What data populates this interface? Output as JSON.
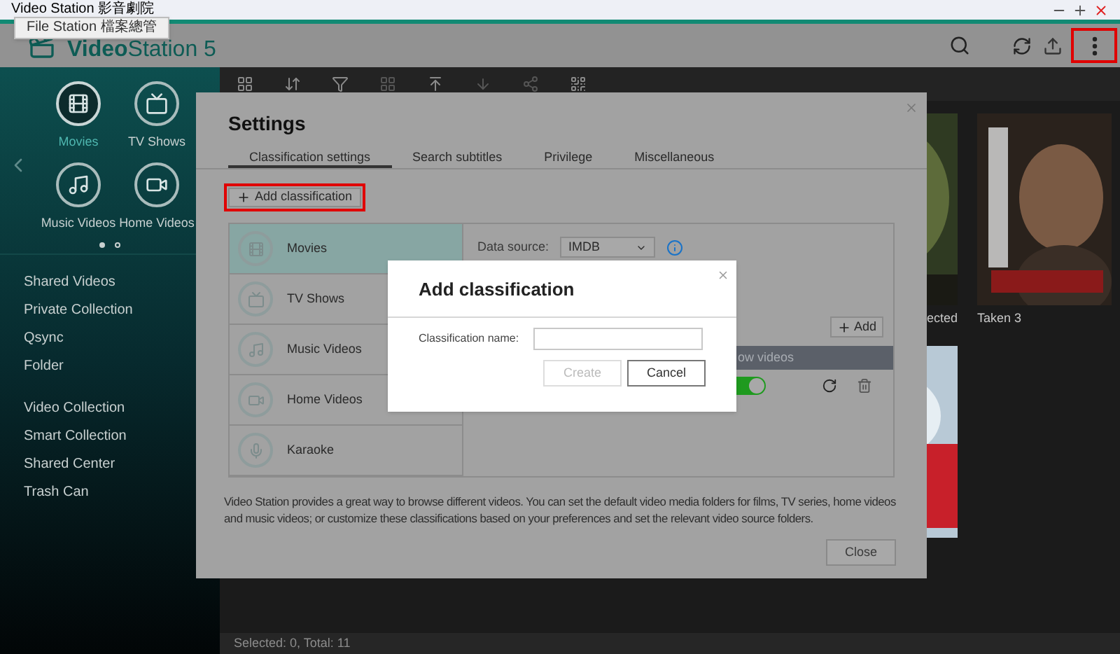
{
  "title_bar": {
    "title": "Video Station 影音劇院"
  },
  "tooltip": {
    "text": "File Station 檔案總管"
  },
  "header": {
    "logo": "**Video**Station 5"
  },
  "sidebar": {
    "apps": [
      {
        "kind": "film",
        "label": "Movies",
        "selected": true
      },
      {
        "kind": "tv",
        "label": "TV Shows",
        "selected": false
      },
      {
        "kind": "music",
        "label": "Music Videos",
        "selected": false
      },
      {
        "kind": "camera",
        "label": "Home Videos",
        "selected": false
      }
    ],
    "page_dots": [
      {
        "selected": true
      },
      {
        "selected": false
      }
    ],
    "groups": [
      [
        "Shared Videos",
        "Private Collection",
        "Qsync",
        "Folder"
      ],
      [
        "Video Collection",
        "Smart Collection",
        "Shared Center",
        "Trash Can"
      ]
    ]
  },
  "content": {
    "posters": [
      {
        "caption": "ected"
      },
      {
        "caption": "Taken 3"
      }
    ],
    "status": "Selected: 0, Total: 11"
  },
  "settings": {
    "title": "Settings",
    "tabs": [
      {
        "label": "Classification settings",
        "selected": true
      },
      {
        "label": "Search subtitles",
        "selected": false
      },
      {
        "label": "Privilege",
        "selected": false
      },
      {
        "label": "Miscellaneous",
        "selected": false
      }
    ],
    "add_button": "Add classification",
    "classifications": [
      {
        "kind": "film",
        "label": "Movies",
        "selected": true
      },
      {
        "kind": "tv",
        "label": "TV Shows",
        "selected": false
      },
      {
        "kind": "music",
        "label": "Music Videos",
        "selected": false
      },
      {
        "kind": "camera",
        "label": "Home Videos",
        "selected": false
      },
      {
        "kind": "mic",
        "label": "Karaoke",
        "selected": false
      }
    ],
    "data_source": {
      "label": "Data source:",
      "value": "IMDB"
    },
    "folder_add_button": "Add",
    "folder_header": "ow videos",
    "folder_toggle": {
      "on": true
    },
    "description": "Video Station provides a great way to browse different videos. You can set the default video media folders for films, TV series, home videos and music videos; or customize these classifications based on your preferences and set the relevant video source folders.",
    "close_button": "Close"
  },
  "dialog": {
    "title": "Add classification",
    "field_label": "Classification name:",
    "create_button": {
      "label": "Create",
      "disabled": true
    },
    "cancel_button": "Cancel"
  }
}
